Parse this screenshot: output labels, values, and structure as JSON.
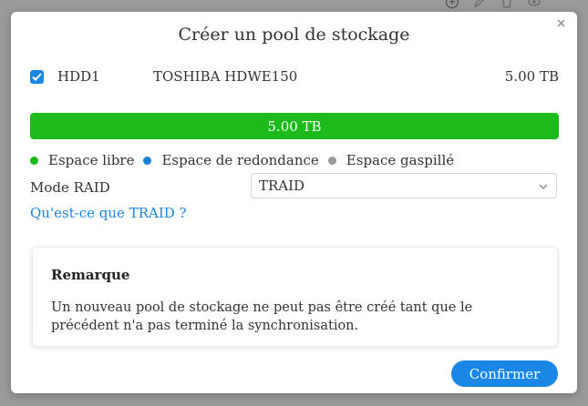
{
  "dialog": {
    "title": "Créer un pool de stockage"
  },
  "disk": {
    "checked": true,
    "name": "HDD1",
    "model": "TOSHIBA HDWE150",
    "size": "5.00 TB"
  },
  "capacity_bar": {
    "label": "5.00 TB",
    "fill_fraction": 1.0,
    "color": "#1dba1b"
  },
  "legend": [
    {
      "label": "Espace libre",
      "color": "#1dba1b"
    },
    {
      "label": "Espace de redondance",
      "color": "#1a7fd6"
    },
    {
      "label": "Espace gaspillé",
      "color": "#9a9a9a"
    }
  ],
  "raid": {
    "label": "Mode RAID",
    "selected": "TRAID"
  },
  "help_link": "Qu'est-ce que TRAID ?",
  "remark": {
    "title": "Remarque",
    "text": "Un nouveau pool de stockage ne peut pas être créé tant que le précédent n'a pas terminé la synchronisation."
  },
  "buttons": {
    "confirm": "Confirmer"
  },
  "colors": {
    "accent": "#1a86e5",
    "overlay": "#9a9a9a"
  }
}
